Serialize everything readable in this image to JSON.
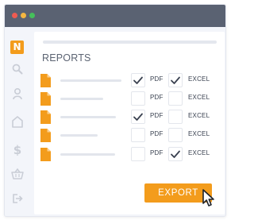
{
  "window": {
    "controls": [
      "close",
      "minimize",
      "maximize"
    ],
    "control_colors": {
      "close": "#ef5b51",
      "minimize": "#f4b641",
      "maximize": "#45c05b"
    }
  },
  "sidebar": {
    "logo": "N",
    "logo_color": "#f39c1c",
    "items": [
      {
        "icon": "search-icon"
      },
      {
        "icon": "user-icon"
      },
      {
        "icon": "home-icon"
      },
      {
        "icon": "dollar-icon"
      },
      {
        "icon": "basket-icon"
      },
      {
        "icon": "logout-icon"
      }
    ]
  },
  "reports": {
    "title": "REPORTS",
    "pdf_label": "PDF",
    "excel_label": "EXCEL",
    "rows": [
      {
        "icon": "file-icon",
        "pdf_checked": true,
        "excel_checked": true
      },
      {
        "icon": "file-icon",
        "pdf_checked": false,
        "excel_checked": false
      },
      {
        "icon": "file-icon",
        "pdf_checked": true,
        "excel_checked": false
      },
      {
        "icon": "file-icon",
        "pdf_checked": false,
        "excel_checked": false
      },
      {
        "icon": "file-icon",
        "pdf_checked": false,
        "excel_checked": true
      }
    ]
  },
  "export": {
    "label": "EXPORT",
    "color": "#f39c1c"
  }
}
